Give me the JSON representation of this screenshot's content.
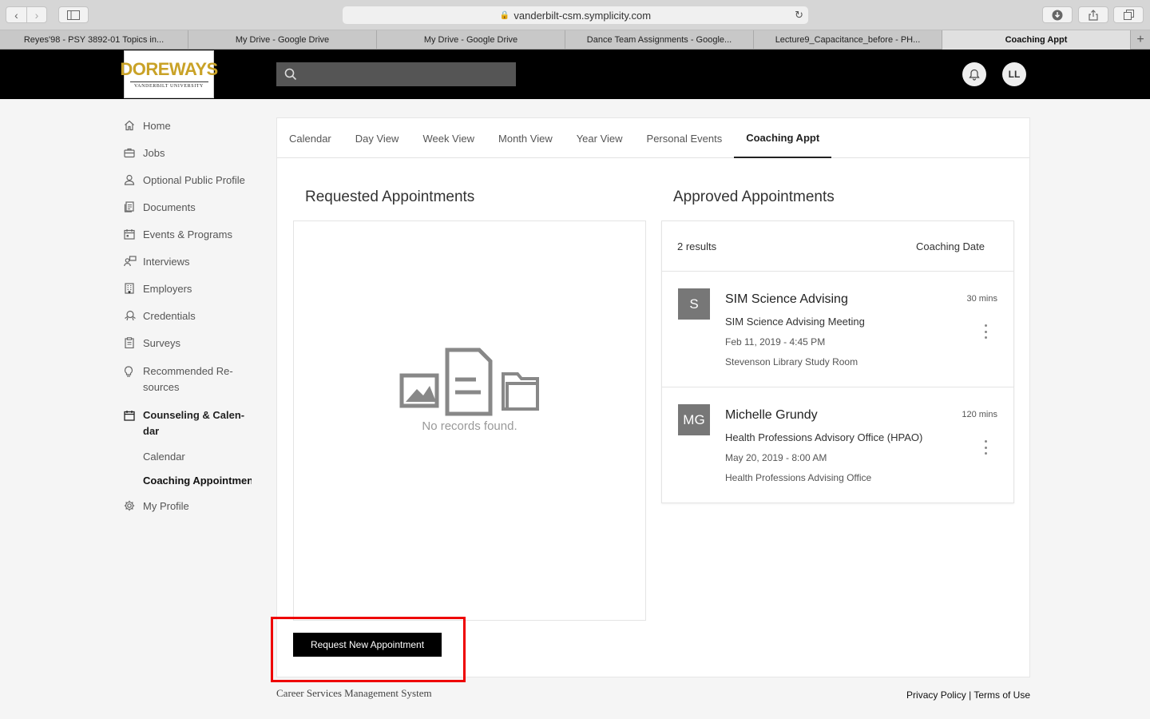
{
  "browser": {
    "url": "vanderbilt-csm.symplicity.com",
    "tabs": [
      {
        "label": "Reyes'98 - PSY 3892-01 Topics in..."
      },
      {
        "label": "My Drive - Google Drive"
      },
      {
        "label": "My Drive - Google Drive"
      },
      {
        "label": "Dance Team Assignments - Google..."
      },
      {
        "label": "Lecture9_Capacitance_before - PH..."
      },
      {
        "label": "Coaching Appt"
      }
    ],
    "new_tab": "+"
  },
  "header": {
    "logo_word": "DOREWAYS",
    "logo_sub": "VANDERBILT  UNIVERSITY",
    "search_placeholder": "",
    "user_initials": "LL"
  },
  "leftnav": {
    "items": [
      {
        "label": "Home",
        "icon": "home-icon"
      },
      {
        "label": "Jobs",
        "icon": "briefcase-icon"
      },
      {
        "label": "Optional Public Profile",
        "icon": "person-icon"
      },
      {
        "label": "Documents",
        "icon": "documents-icon"
      },
      {
        "label": "Events & Programs",
        "icon": "calendar-icon"
      },
      {
        "label": "Interviews",
        "icon": "interview-icon"
      },
      {
        "label": "Employers",
        "icon": "building-icon"
      },
      {
        "label": "Credentials",
        "icon": "credential-icon"
      },
      {
        "label": "Surveys",
        "icon": "clipboard-icon"
      },
      {
        "label_1": "Recommended Re-",
        "label_2": "sources",
        "icon": "lightbulb-icon"
      },
      {
        "label_1": "Counseling & Calen-",
        "label_2": "dar",
        "icon": "calendar-icon"
      },
      {
        "label": "My Profile",
        "icon": "gear-icon"
      }
    ],
    "sub_items": [
      {
        "label": "Calendar"
      },
      {
        "label": "Coaching Appointments"
      }
    ]
  },
  "view_tabs": [
    {
      "label": "Calendar"
    },
    {
      "label": "Day View"
    },
    {
      "label": "Week View"
    },
    {
      "label": "Month View"
    },
    {
      "label": "Year View"
    },
    {
      "label": "Personal Events"
    },
    {
      "label": "Coaching Appt"
    }
  ],
  "requested": {
    "title": "Requested Appointments",
    "empty_text": "No records found."
  },
  "approved": {
    "title": "Approved Appointments",
    "count": "2 results",
    "sort_label": "Coaching Date",
    "items": [
      {
        "initials": "S",
        "name": "SIM Science Advising",
        "duration": "30 mins",
        "type": "SIM Science Advising Meeting",
        "date": "Feb 11, 2019 - 4:45 PM",
        "location": "Stevenson Library Study Room"
      },
      {
        "initials": "MG",
        "name": "Michelle Grundy",
        "duration": "120 mins",
        "type": "Health Professions Advisory Office (HPAO)",
        "date": "May 20, 2019 - 8:00 AM",
        "location": "Health Professions Advising Office"
      }
    ]
  },
  "actions": {
    "request_new": "Request New Appointment"
  },
  "footer": {
    "system_name": "Career Services Management System",
    "privacy": "Privacy Policy",
    "separator": "|",
    "terms": "Terms of Use"
  },
  "colors": {
    "highlight": "#e00000",
    "header_bg": "#000000",
    "logo_gold": "#c9a227"
  }
}
